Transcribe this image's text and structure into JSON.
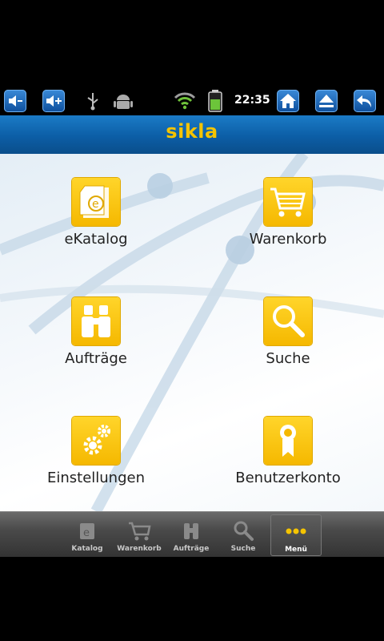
{
  "status_bar": {
    "time": "22:35",
    "icons": [
      "volume-down-icon",
      "volume-up-icon",
      "usb-icon",
      "android-icon",
      "wifi-icon",
      "battery-icon",
      "home-icon",
      "eject-icon",
      "back-icon"
    ]
  },
  "header": {
    "logo": "sikla",
    "brand_color": "#f5c400",
    "bar_color": "#0c5ea6"
  },
  "menu": {
    "items": [
      {
        "label": "eKatalog",
        "icon": "catalog-icon"
      },
      {
        "label": "Warenkorb",
        "icon": "cart-icon"
      },
      {
        "label": "Aufträge",
        "icon": "binoculars-icon"
      },
      {
        "label": "Suche",
        "icon": "magnifier-icon"
      },
      {
        "label": "Einstellungen",
        "icon": "gears-icon"
      },
      {
        "label": "Benutzerkonto",
        "icon": "badge-icon"
      }
    ]
  },
  "tabs": [
    {
      "label": "Katalog",
      "icon": "catalog-icon"
    },
    {
      "label": "Warenkorb",
      "icon": "cart-icon"
    },
    {
      "label": "Aufträge",
      "icon": "binoculars-icon"
    },
    {
      "label": "Suche",
      "icon": "magnifier-icon"
    },
    {
      "label": "Menü",
      "icon": "more-icon",
      "active": true
    }
  ]
}
